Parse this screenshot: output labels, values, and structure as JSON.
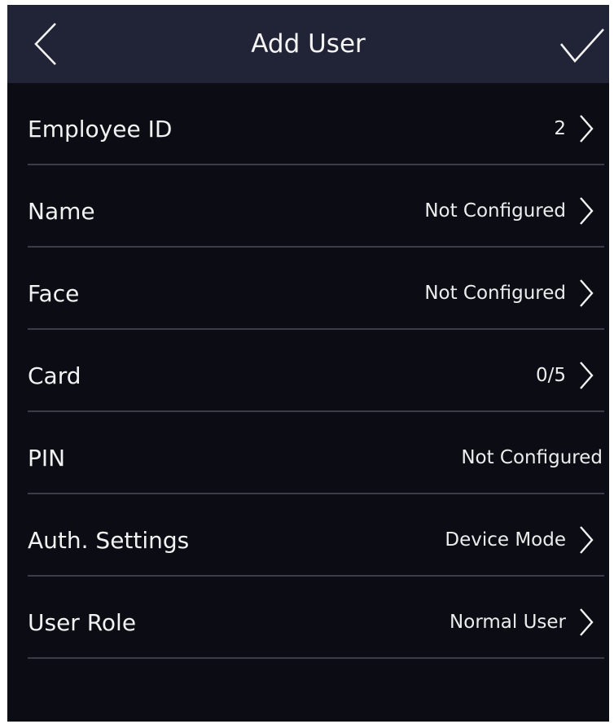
{
  "header": {
    "title": "Add User",
    "back_icon": "chevron-left-icon",
    "confirm_icon": "checkmark-icon"
  },
  "fields": [
    {
      "key": "employee-id",
      "label": "Employee ID",
      "value": "2",
      "chevron": true
    },
    {
      "key": "name",
      "label": "Name",
      "value": "Not Configured",
      "chevron": true
    },
    {
      "key": "face",
      "label": "Face",
      "value": "Not Configured",
      "chevron": true
    },
    {
      "key": "card",
      "label": "Card",
      "value": "0/5",
      "chevron": true
    },
    {
      "key": "pin",
      "label": "PIN",
      "value": "Not Configured",
      "chevron": false
    },
    {
      "key": "auth-settings",
      "label": "Auth. Settings",
      "value": "Device Mode",
      "chevron": true
    },
    {
      "key": "user-role",
      "label": "User Role",
      "value": "Normal User",
      "chevron": true
    }
  ],
  "colors": {
    "background": "#0b0c14",
    "header": "#212436",
    "divider": "#3a3c46",
    "text": "#f2f2f2"
  }
}
